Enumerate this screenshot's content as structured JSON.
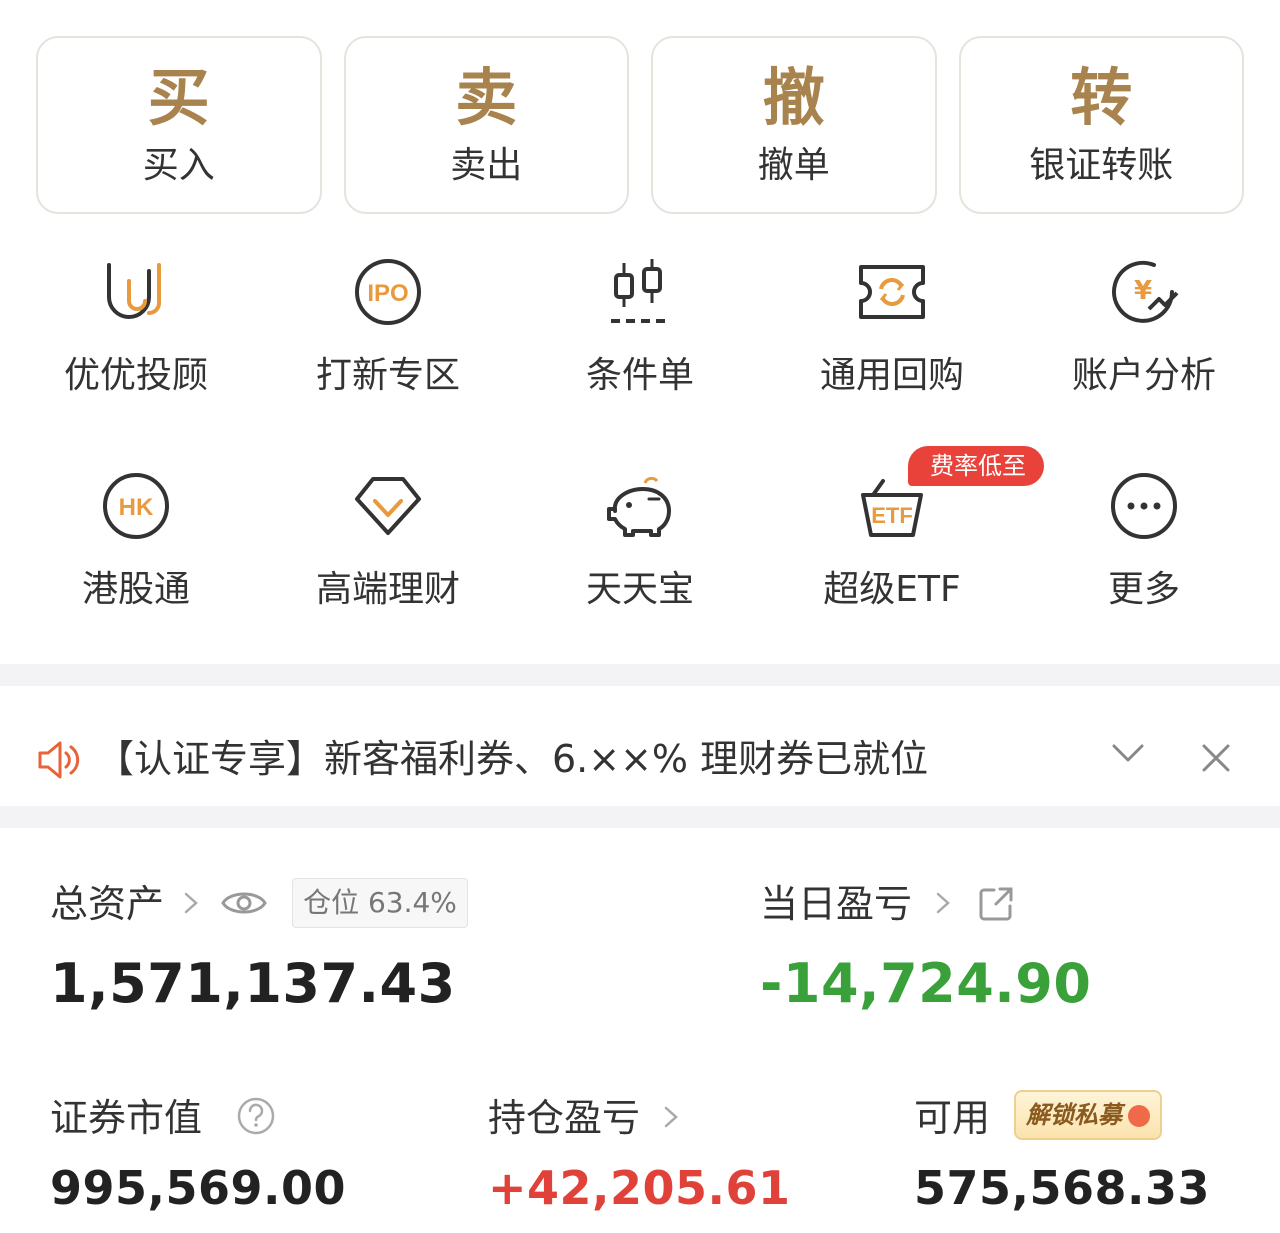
{
  "trade": [
    {
      "big": "买",
      "label": "买入"
    },
    {
      "big": "卖",
      "label": "卖出"
    },
    {
      "big": "撤",
      "label": "撤单"
    },
    {
      "big": "转",
      "label": "银证转账"
    }
  ],
  "grid_row1": [
    {
      "icon": "youyou-advisor-icon",
      "label": "优优投顾"
    },
    {
      "icon": "ipo-icon",
      "label": "打新专区",
      "icon_text": "IPO"
    },
    {
      "icon": "candlestick-icon",
      "label": "条件单"
    },
    {
      "icon": "repo-ticket-icon",
      "label": "通用回购"
    },
    {
      "icon": "yen-chart-icon",
      "label": "账户分析",
      "icon_text": "¥"
    }
  ],
  "grid_row2": [
    {
      "icon": "hk-icon",
      "label": "港股通",
      "icon_text": "HK"
    },
    {
      "icon": "diamond-icon",
      "label": "高端理财"
    },
    {
      "icon": "piggy-bank-icon",
      "label": "天天宝"
    },
    {
      "icon": "etf-basket-icon",
      "label": "超级ETF",
      "icon_text": "ETF",
      "badge": "费率低至"
    },
    {
      "icon": "more-icon",
      "label": "更多"
    }
  ],
  "notice": {
    "text": "【认证专享】新客福利券、6.××% 理财券已就位"
  },
  "assets": {
    "total_label": "总资产",
    "total_value": "1,571,137.43",
    "position_pill": "仓位 63.4%",
    "daily_pl_label": "当日盈亏",
    "daily_pl_value": "-14,724.90",
    "securities_label": "证券市值",
    "securities_value": "995,569.00",
    "holding_pl_label": "持仓盈亏",
    "holding_pl_value": "+42,205.61",
    "available_label": "可用",
    "available_value": "575,568.33",
    "unlock_label": "解锁私募"
  },
  "colors": {
    "gold": "#a9834e",
    "orange_icon": "#e89a3c",
    "loss_green": "#3aa13a",
    "gain_red": "#e0423a",
    "badge_red": "#e8423a"
  }
}
